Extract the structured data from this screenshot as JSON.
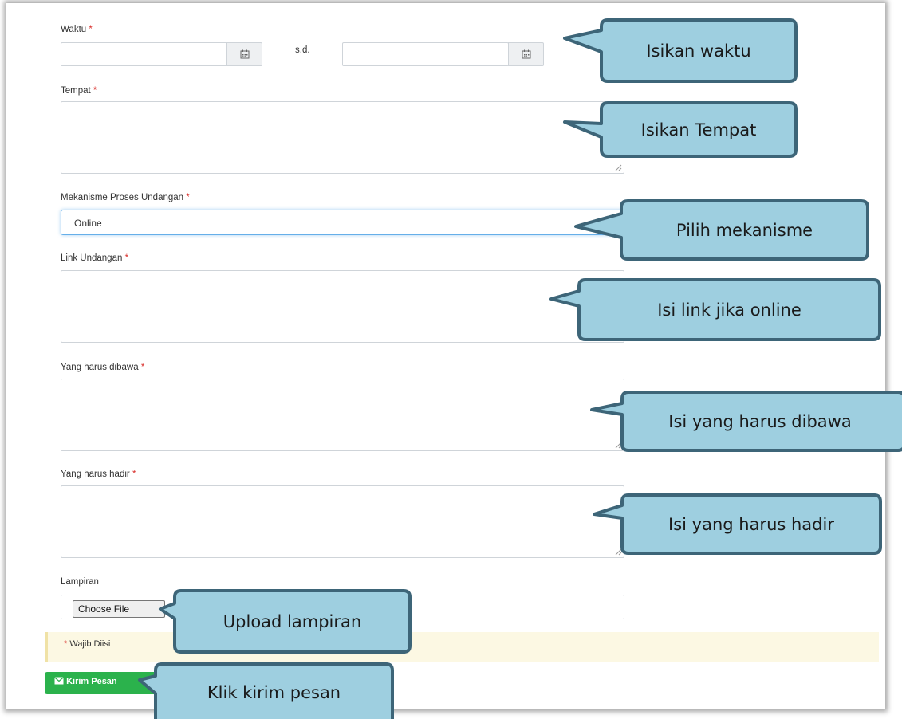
{
  "form": {
    "waktu_label": "Waktu",
    "sd_label": "s.d.",
    "tempat_label": "Tempat",
    "mekanisme_label": "Mekanisme Proses Undangan",
    "mekanisme_value": "Online",
    "link_label": "Link Undangan",
    "dibawa_label": "Yang harus dibawa",
    "hadir_label": "Yang harus hadir",
    "lampiran_label": "Lampiran",
    "choose_file_label": "Choose File",
    "required_marker": "*",
    "wajib_text": "Wajib Diisi",
    "send_label": "Kirim Pesan"
  },
  "icons": {
    "calendar": "calendar-icon",
    "envelope": "envelope-icon"
  },
  "colors": {
    "callout_fill": "#9ecfe0",
    "callout_border": "#3d6578",
    "send_button": "#2bb24c",
    "required": "#d9302c"
  },
  "callouts": {
    "waktu": "Isikan waktu",
    "tempat": "Isikan Tempat",
    "mekanisme": "Pilih mekanisme",
    "link": "Isi link jika online",
    "dibawa": "Isi yang harus dibawa",
    "hadir": "Isi yang harus hadir",
    "lampiran": "Upload lampiran",
    "kirim": "Klik kirim pesan"
  }
}
